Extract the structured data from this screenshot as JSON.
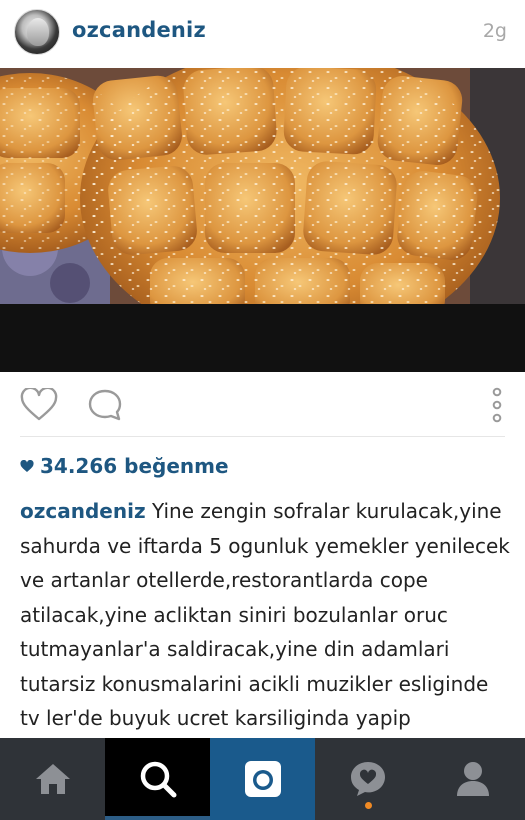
{
  "post": {
    "username": "ozcandeniz",
    "time_ago": "2g",
    "likes_count": "34.266",
    "likes_suffix": "beğenme",
    "caption_user": "ozcandeniz",
    "caption_text": "Yine zengin sofralar kurulacak,yine sahurda ve iftarda 5 ogunluk yemekler yenilecek ve artanlar otellerde,restorantlarda cope atilacak,yine acliktan siniri bozulanlar oruc tutmayanlar'a saldiracak,yine din adamlari tutarsiz konusmalarini acikli muzikler esliginde tv ler'de buyuk ucret karsiliginda yapip"
  },
  "icons": {
    "like": "heart-outline-icon",
    "comment": "comment-bubble-icon",
    "more": "vertical-dots-icon",
    "likes_heart": "heart-filled-icon",
    "nav": [
      "home-icon",
      "search-icon",
      "camera-icon",
      "activity-icon",
      "profile-icon"
    ]
  },
  "colors": {
    "username": "#1e5781",
    "nav_background": "#2f3338",
    "nav_active_search": "#000000",
    "nav_camera": "#1a5a8c",
    "notification_dot": "#f08a24",
    "timestamp": "#a8a8a8"
  }
}
